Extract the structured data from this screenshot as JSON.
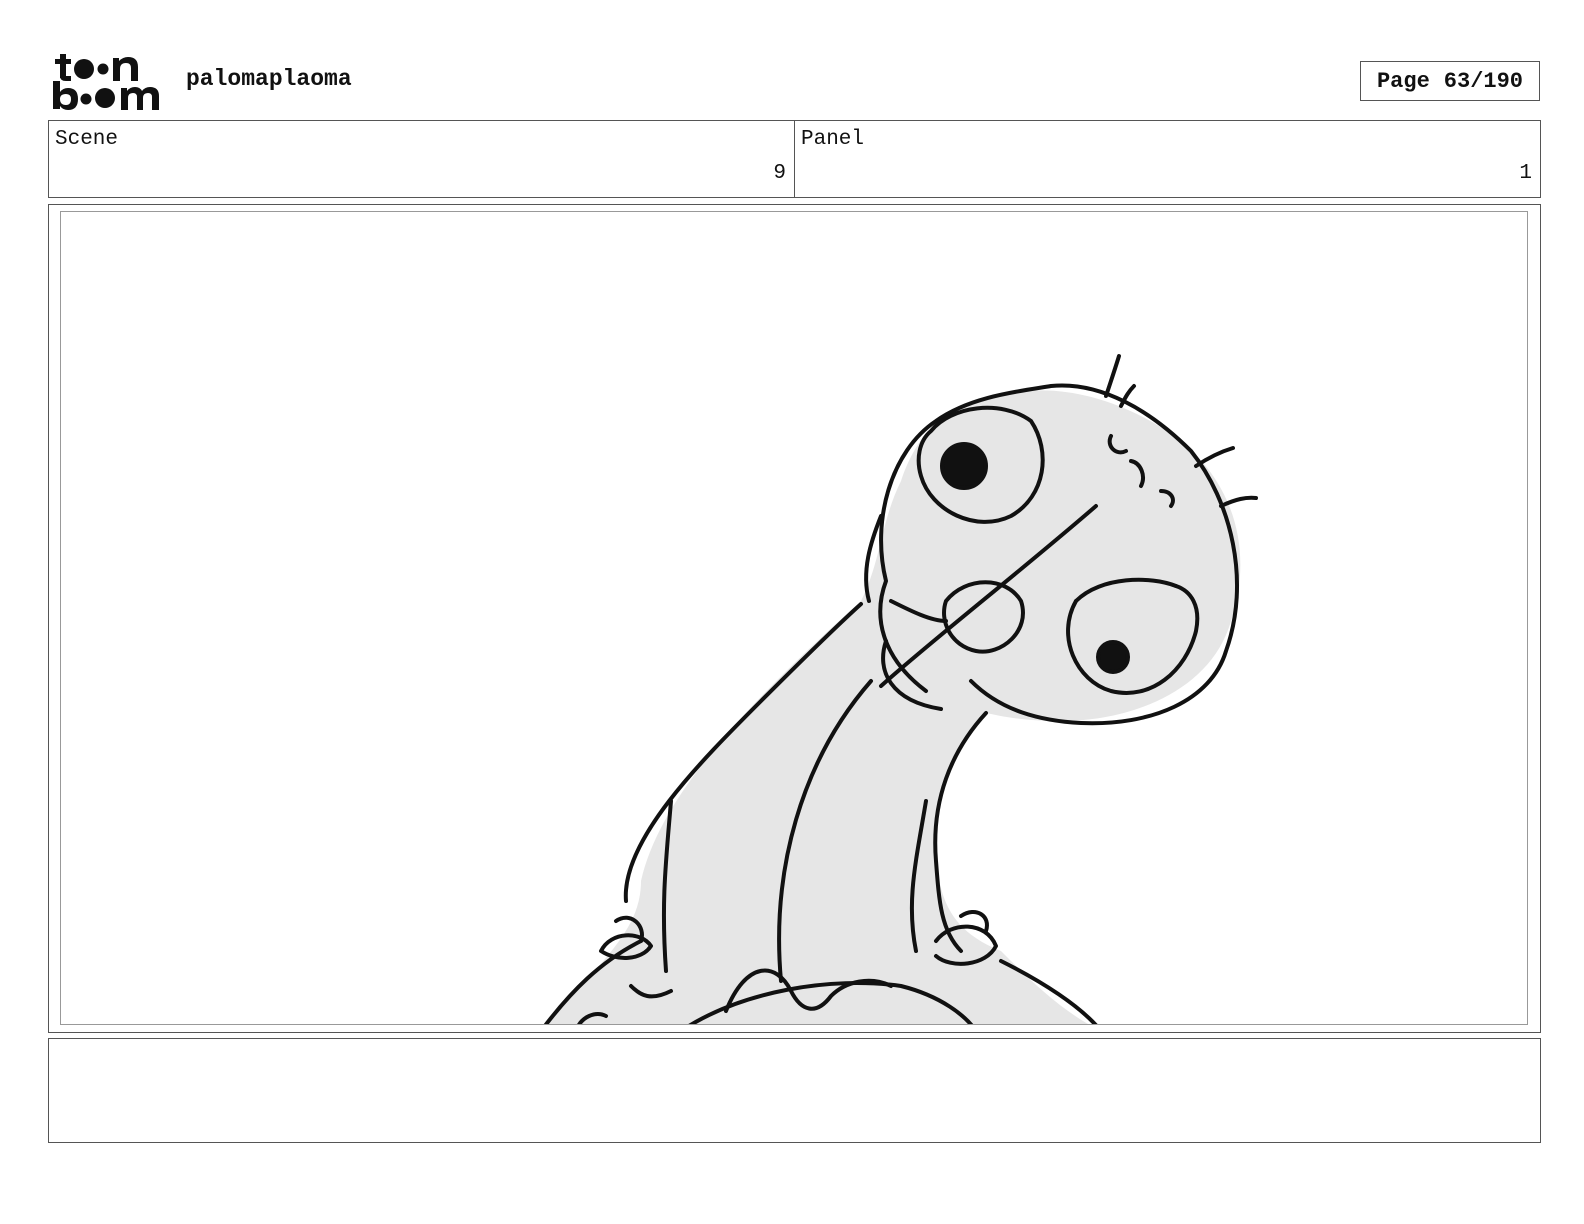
{
  "header": {
    "logo_text": "toon boom",
    "project_name": "palomaplaoma",
    "page_label": "Page",
    "page_number": "63/190"
  },
  "info": {
    "scene_label": "Scene",
    "scene_value": "9",
    "panel_label": "Panel",
    "panel_value": "1"
  },
  "notes": {
    "text": ""
  }
}
